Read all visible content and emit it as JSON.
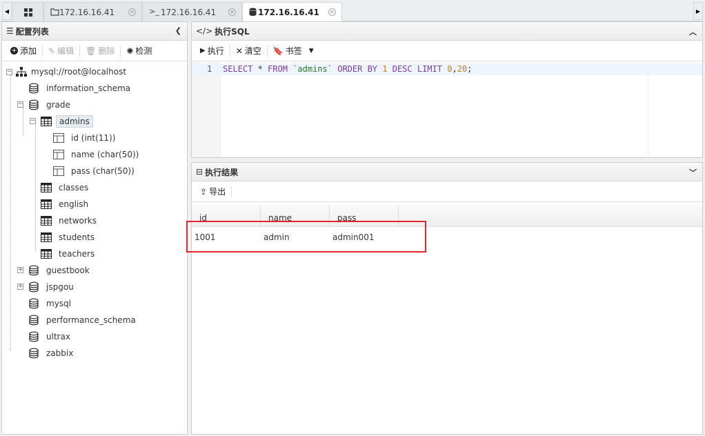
{
  "tabs": [
    {
      "label": "",
      "icon": "grid-icon"
    },
    {
      "label": "172.16.16.41",
      "icon": "folder-icon"
    },
    {
      "label": "172.16.16.41",
      "icon": "terminal-icon"
    },
    {
      "label": "172.16.16.41",
      "icon": "database-icon",
      "active": true
    }
  ],
  "left": {
    "title": "配置列表",
    "toolbar": {
      "add": "添加",
      "edit": "编辑",
      "delete": "删除",
      "check": "检测"
    },
    "tree": {
      "root": "mysql://root@localhost",
      "dbs": [
        "information_schema",
        "grade",
        "guestbook",
        "jspgou",
        "mysql",
        "performance_schema",
        "ultrax",
        "zabbix"
      ],
      "grade_tables": [
        "admins",
        "classes",
        "english",
        "networks",
        "students",
        "teachers"
      ],
      "admins_columns": [
        "id (int(11))",
        "name (char(50))",
        "pass (char(50))"
      ]
    }
  },
  "sql": {
    "title": "执行SQL",
    "toolbar": {
      "run": "执行",
      "clear": "清空",
      "bookmark": "书签"
    },
    "line_number": "1",
    "tokens": {
      "t1": "SELECT",
      "t2": " * ",
      "t3": "FROM",
      "t4": " ",
      "t5": "`admins`",
      "t6": " ",
      "t7": "ORDER BY",
      "t8": " ",
      "t9": "1",
      "t10": " ",
      "t11": "DESC",
      "t12": " ",
      "t13": "LIMIT",
      "t14": " ",
      "t15": "0",
      "t16": ",",
      "t17": "20",
      "t18": ";"
    }
  },
  "result": {
    "title": "执行结果",
    "toolbar": {
      "export": "导出"
    },
    "columns": [
      "id",
      "name",
      "pass"
    ],
    "rows": [
      [
        "1001",
        "admin",
        "admin001"
      ]
    ]
  },
  "colors": {
    "highlight": "#e2262b",
    "keyword": "#7b3fa8",
    "string": "#2c7a2c",
    "number": "#d47b12"
  }
}
